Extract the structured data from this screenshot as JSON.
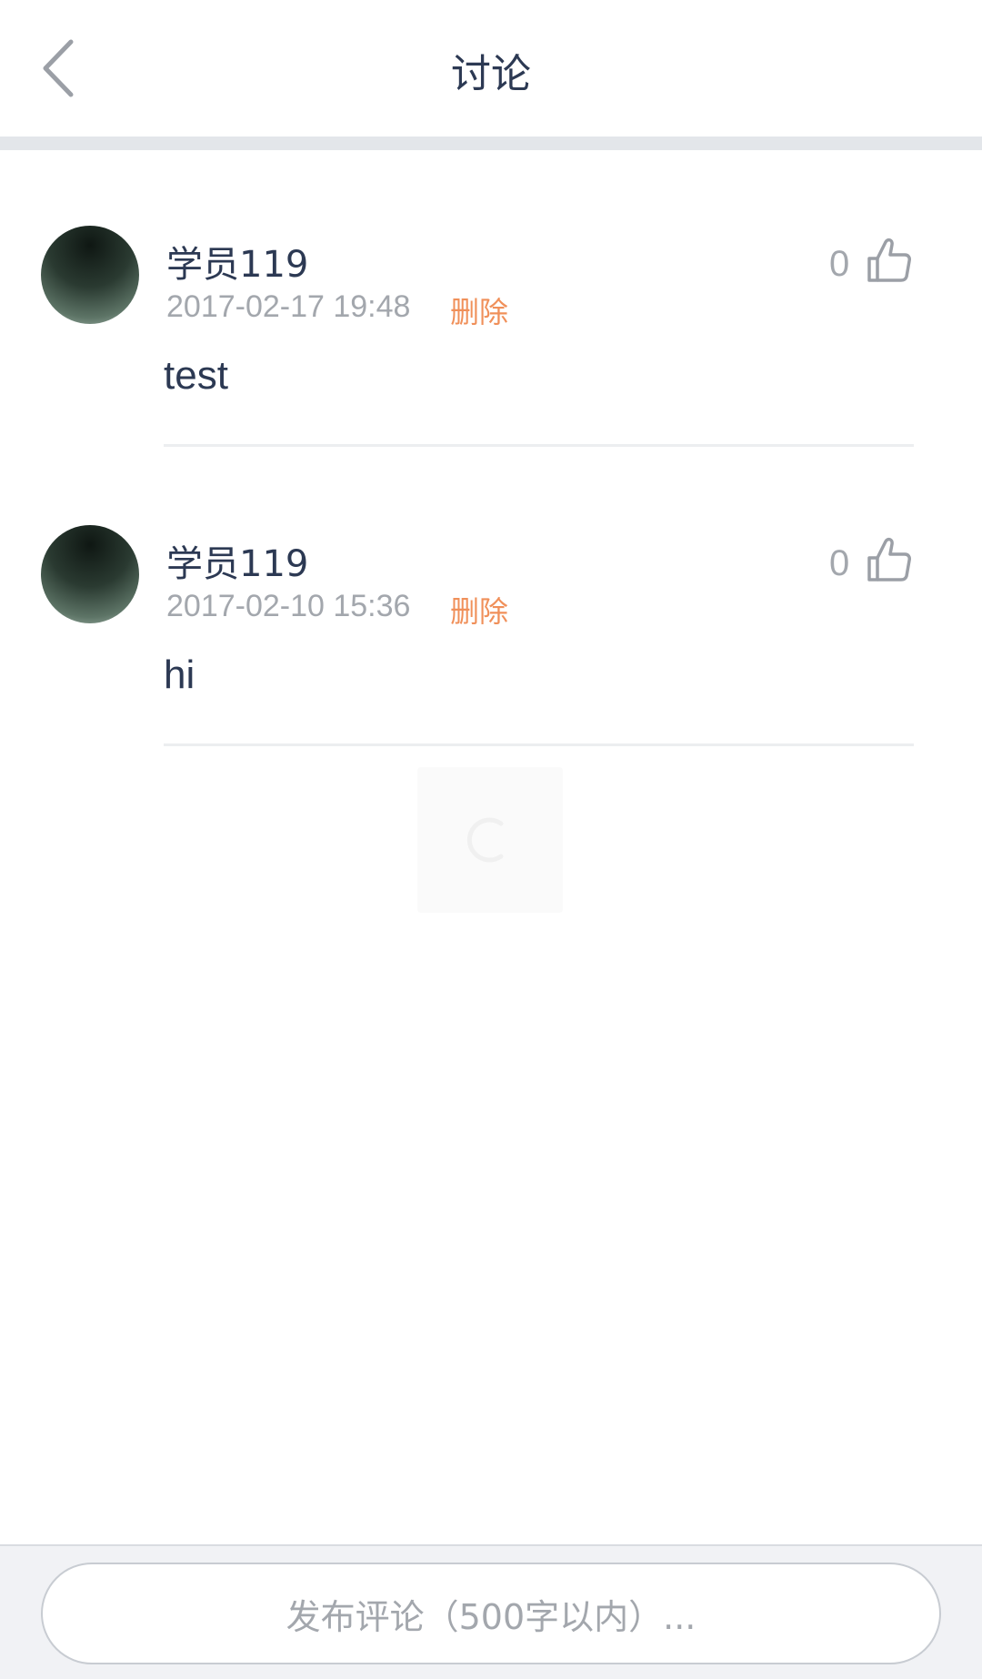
{
  "header": {
    "title": "讨论",
    "back_icon": "chevron-left-icon"
  },
  "comments": [
    {
      "username": "学员119",
      "timestamp": "2017-02-17 19:48",
      "delete_label": "删除",
      "like_count": "0",
      "text": "test"
    },
    {
      "username": "学员119",
      "timestamp": "2017-02-10 15:36",
      "delete_label": "删除",
      "like_count": "0",
      "text": "hi"
    }
  ],
  "composer": {
    "placeholder": "发布评论（500字以内）..."
  },
  "colors": {
    "title": "#2c3953",
    "muted": "#a3a7ad",
    "delete": "#f0905a",
    "divider": "#e3e6ea"
  }
}
